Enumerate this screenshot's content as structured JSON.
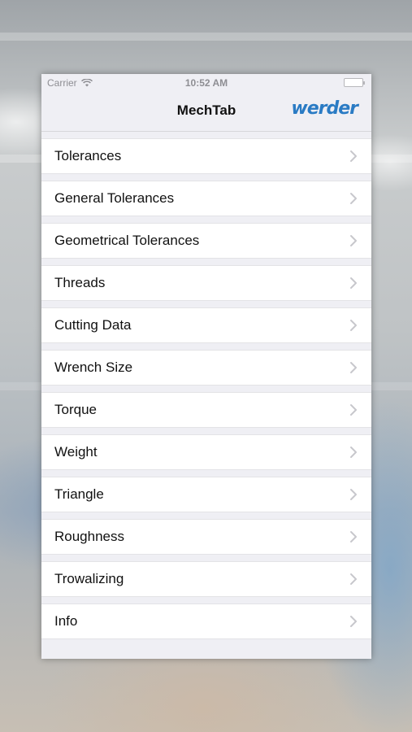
{
  "status_bar": {
    "carrier": "Carrier",
    "time": "10:52 AM"
  },
  "nav": {
    "title": "MechTab",
    "logo_text": "werder"
  },
  "menu": {
    "items": [
      {
        "label": "Tolerances"
      },
      {
        "label": "General Tolerances"
      },
      {
        "label": "Geometrical Tolerances"
      },
      {
        "label": "Threads"
      },
      {
        "label": "Cutting Data"
      },
      {
        "label": "Wrench Size"
      },
      {
        "label": "Torque"
      },
      {
        "label": "Weight"
      },
      {
        "label": "Triangle"
      },
      {
        "label": "Roughness"
      },
      {
        "label": "Trowalizing"
      },
      {
        "label": "Info"
      }
    ]
  },
  "colors": {
    "logo": "#2a7bc4",
    "list_background": "#efeff4",
    "chevron": "#c7c7cc"
  },
  "icons": [
    "wifi-icon",
    "battery-icon",
    "chevron-right-icon"
  ]
}
